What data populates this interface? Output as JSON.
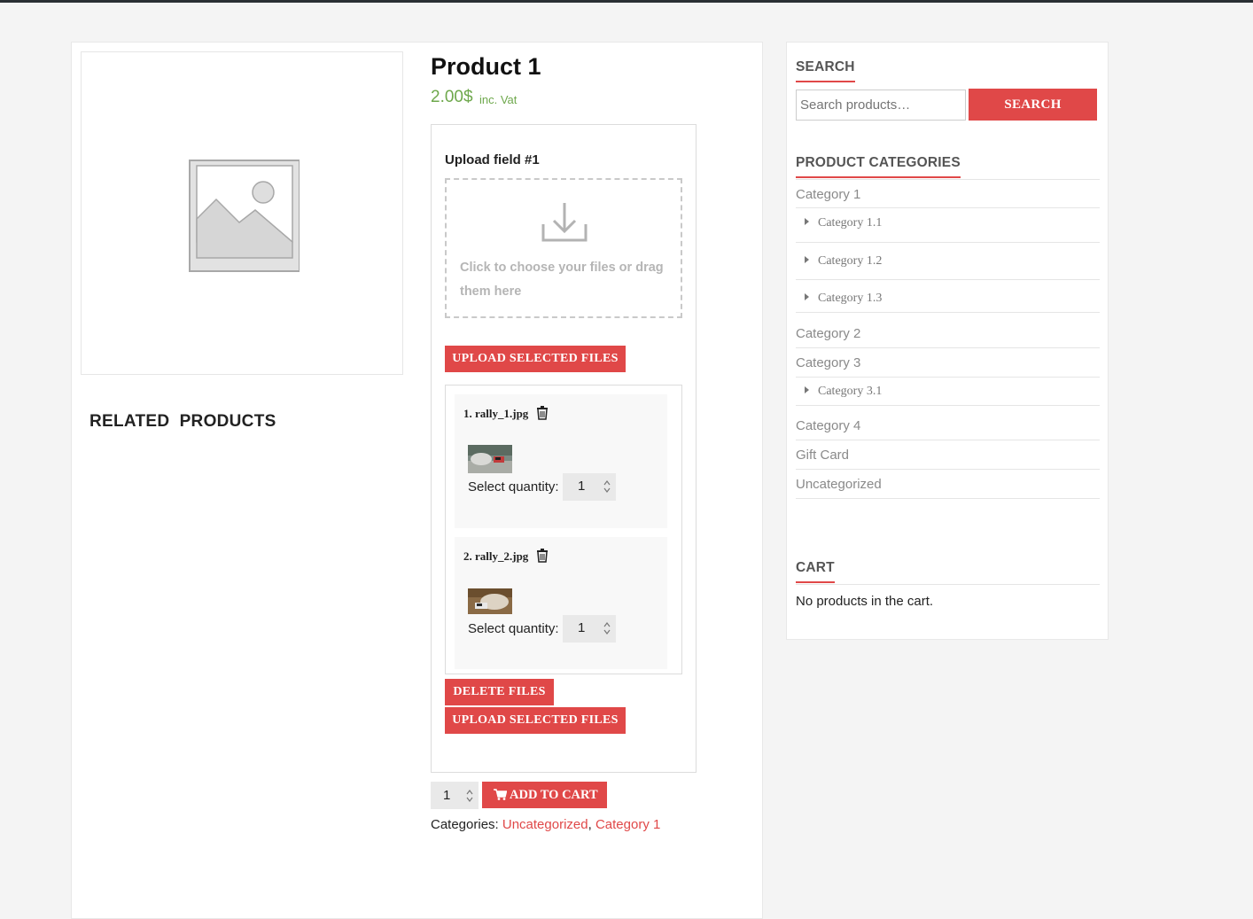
{
  "product": {
    "title": "Product 1",
    "price": "2.00$",
    "price_note": "inc. Vat"
  },
  "related": {
    "title": "RELATED  PRODUCTS"
  },
  "upload": {
    "field_label": "Upload field #1",
    "dropzone_text": "Click to choose your files or drag them here",
    "upload_button": "UPLOAD SELECTED FILES",
    "delete_button": "DELETE FILES",
    "files": [
      {
        "name": "1. rally_1.jpg",
        "qty_label": "Select quantity:",
        "qty": "1"
      },
      {
        "name": "2. rally_2.jpg",
        "qty_label": "Select quantity:",
        "qty": "1"
      }
    ]
  },
  "cart_form": {
    "qty": "1",
    "add_button": "ADD TO CART",
    "categories_label": "Categories: ",
    "categories": [
      "Uncategorized",
      "Category 1"
    ],
    "separator": ", "
  },
  "sidebar": {
    "search": {
      "title": "SEARCH",
      "placeholder": "Search products…",
      "button": "SEARCH"
    },
    "categories": {
      "title": "PRODUCT CATEGORIES",
      "items": [
        {
          "label": "Category 1",
          "children": [
            "Category 1.1",
            "Category 1.2",
            "Category 1.3"
          ]
        },
        {
          "label": "Category 2",
          "children": []
        },
        {
          "label": "Category 3",
          "children": [
            "Category 3.1"
          ]
        },
        {
          "label": "Category 4",
          "children": []
        },
        {
          "label": "Gift Card",
          "children": []
        },
        {
          "label": "Uncategorized",
          "children": []
        }
      ]
    },
    "cart": {
      "title": "CART",
      "empty_text": "No products in the cart."
    }
  },
  "colors": {
    "accent": "#e04848",
    "price": "#6ea84c",
    "topbar": "#2a2f33"
  }
}
